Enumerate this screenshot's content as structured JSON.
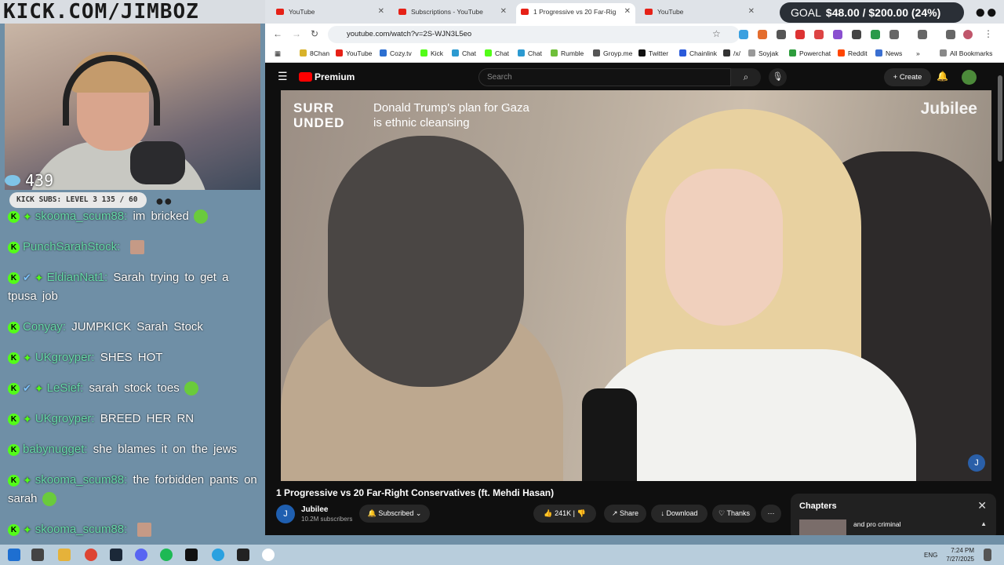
{
  "overlay": {
    "title": "KICK.COM/JIMBOZ",
    "viewers": "439",
    "subs_label": "KICK SUBS: LEVEL 3 135 / 60",
    "goal_label": "GOAL",
    "goal_value": "$48.00 / $200.00 (24%)"
  },
  "chat": {
    "messages": [
      {
        "user": "skooma_scum88:",
        "text": "im bricked"
      },
      {
        "user": "PunchSarahStock:",
        "text": ""
      },
      {
        "user": "EldianNat1:",
        "text": "Sarah trying to get a tpusa job"
      },
      {
        "user": "Conyay:",
        "text": "JUMPKICK Sarah Stock"
      },
      {
        "user": "UKgroyper:",
        "text": "SHES HOT"
      },
      {
        "user": "LeSief:",
        "text": "sarah stock toes"
      },
      {
        "user": "UKgroyper:",
        "text": "BREED HER RN"
      },
      {
        "user": "babynugget:",
        "text": "she blames it on the jews"
      },
      {
        "user": "skooma_scum88:",
        "text": "the forbidden pants on sarah"
      },
      {
        "user": "skooma_scum88:",
        "text": ""
      }
    ]
  },
  "browser": {
    "tabs": [
      {
        "label": "YouTube"
      },
      {
        "label": "Subscriptions - YouTube"
      },
      {
        "label": "1 Progressive vs 20 Far-Rig"
      },
      {
        "label": "YouTube"
      }
    ],
    "url": "youtube.com/watch?v=2S-WJN3L5eo",
    "bookmarks": [
      "8Chan",
      "YouTube",
      "Cozy.tv",
      "Kick",
      "Chat",
      "Chat",
      "Chat",
      "Rumble",
      "Groyp.me",
      "Twitter",
      "Chainlink",
      "/x/",
      "Soyjak",
      "Powerchat",
      "Reddit",
      "News"
    ],
    "all_bookmarks": "All Bookmarks"
  },
  "youtube": {
    "logo": "Premium",
    "search_placeholder": "Search",
    "create_label": "Create",
    "video": {
      "caption_brand": "SURR UNDED",
      "headline": "Donald Trump's plan for Gaza is ethnic cleansing",
      "watermark": "Jubilee",
      "title": "1 Progressive vs 20 Far-Right Conservatives (ft. Mehdi Hasan)"
    },
    "channel": {
      "name": "Jubilee",
      "subs": "10.2M subscribers",
      "subscribed": "Subscribed"
    },
    "actions": {
      "likes": "241K",
      "share": "Share",
      "download": "Download",
      "thanks": "Thanks"
    },
    "chapters": {
      "title": "Chapters",
      "item": "and pro criminal"
    }
  },
  "taskbar": {
    "lang": "ENG",
    "time": "7:24 PM",
    "date": "7/27/2025"
  }
}
